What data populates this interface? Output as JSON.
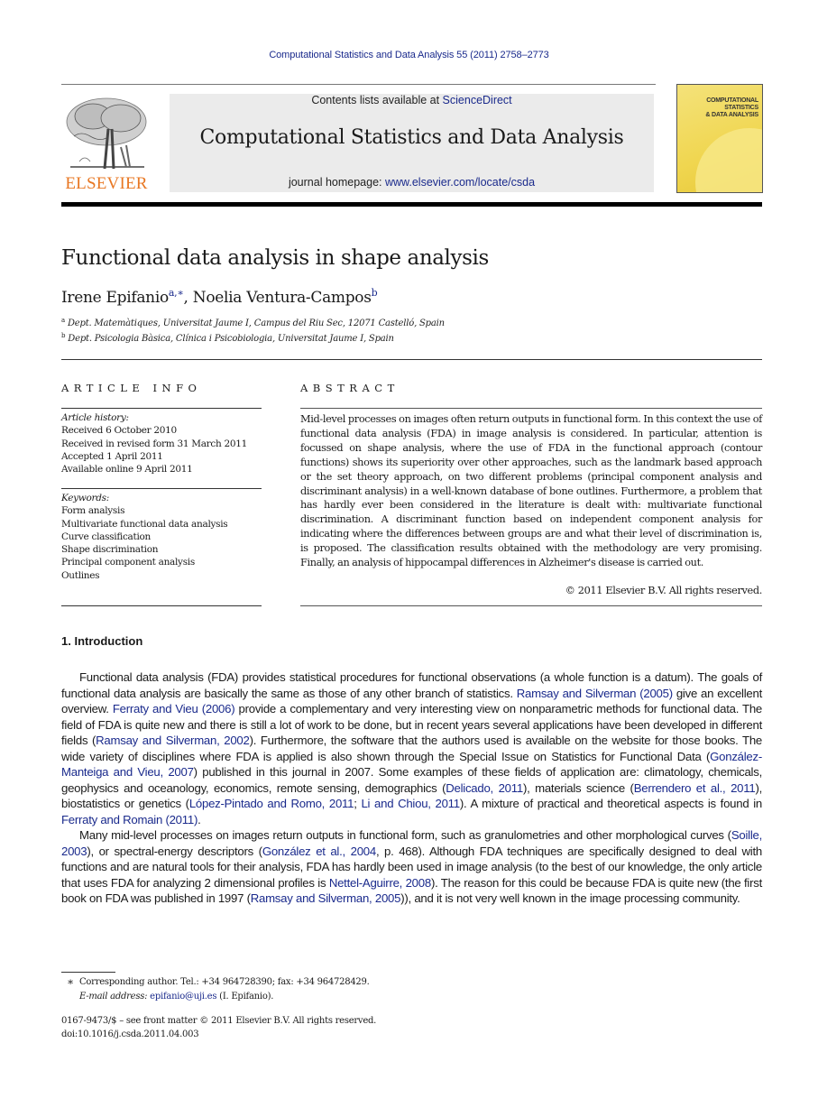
{
  "running_head": "Computational Statistics and Data Analysis 55 (2011) 2758–2773",
  "publisher": {
    "name": "ELSEVIER",
    "brand_color": "#e87722"
  },
  "journal_header": {
    "contents_prefix": "Contents lists available at ",
    "contents_link": "ScienceDirect",
    "journal_name": "Computational Statistics and Data Analysis",
    "homepage_prefix": "journal homepage: ",
    "homepage_link": "www.elsevier.com/locate/csda",
    "cover_title_lines": [
      "COMPUTATIONAL",
      "STATISTICS",
      "& DATA ANALYSIS"
    ]
  },
  "article": {
    "title": "Functional data analysis in shape analysis",
    "authors": [
      {
        "name": "Irene Epifanio",
        "marks": "a,∗"
      },
      {
        "name": "Noelia Ventura-Campos",
        "marks": "b"
      }
    ],
    "author_separator": ", ",
    "affiliations": [
      {
        "mark": "a",
        "text": "Dept. Matemàtiques, Universitat Jaume I, Campus del Riu Sec, 12071 Castelló, Spain"
      },
      {
        "mark": "b",
        "text": "Dept. Psicologia Bàsica, Clínica i Psicobiologia, Universitat Jaume I, Spain"
      }
    ]
  },
  "article_info": {
    "heading": "ARTICLE INFO",
    "history_label": "Article history:",
    "history": [
      "Received 6 October 2010",
      "Received in revised form 31 March 2011",
      "Accepted 1 April 2011",
      "Available online 9 April 2011"
    ],
    "keywords_label": "Keywords:",
    "keywords": [
      "Form analysis",
      "Multivariate functional data analysis",
      "Curve classification",
      "Shape discrimination",
      "Principal component analysis",
      "Outlines"
    ]
  },
  "abstract": {
    "heading": "ABSTRACT",
    "text": "Mid-level processes on images often return outputs in functional form. In this context the use of functional data analysis (FDA) in image analysis is considered. In particular, attention is focussed on shape analysis, where the use of FDA in the functional approach (contour functions) shows its superiority over other approaches, such as the landmark based approach or the set theory approach, on two different problems (principal component analysis and discriminant analysis) in a well-known database of bone outlines. Furthermore, a problem that has hardly ever been considered in the literature is dealt with: multivariate functional discrimination. A discriminant function based on independent component analysis for indicating where the differences between groups are and what their level of discrimination is, is proposed. The classification results obtained with the methodology are very promising. Finally, an analysis of hippocampal differences in Alzheimer's disease is carried out.",
    "copyright": "© 2011 Elsevier B.V. All rights reserved."
  },
  "introduction": {
    "heading": "1.  Introduction",
    "paragraphs": [
      [
        {
          "t": "Functional data analysis (FDA) provides statistical procedures for functional observations (a whole function is a datum). The goals of functional data analysis are basically the same as those of any other branch of statistics. "
        },
        {
          "t": "Ramsay and Silverman (2005)",
          "link": true
        },
        {
          "t": " give an excellent overview. "
        },
        {
          "t": "Ferraty and Vieu (2006)",
          "link": true
        },
        {
          "t": " provide a complementary and very interesting view on nonparametric methods for functional data. The field of FDA is quite new and there is still a lot of work to be done, but in recent years several applications have been developed in different fields ("
        },
        {
          "t": "Ramsay and Silverman, 2002",
          "link": true
        },
        {
          "t": "). Furthermore, the software that the authors used is available on the website for those books. The wide variety of disciplines where FDA is applied is also shown through the Special Issue on Statistics for Functional Data ("
        },
        {
          "t": "González-Manteiga and Vieu, 2007",
          "link": true
        },
        {
          "t": ") published in this journal in 2007. Some examples of these fields of application are: climatology, chemicals, geophysics and oceanology, economics, remote sensing, demographics ("
        },
        {
          "t": "Delicado, 2011",
          "link": true
        },
        {
          "t": "), materials science ("
        },
        {
          "t": "Berrendero et al., 2011",
          "link": true
        },
        {
          "t": "), biostatistics or genetics ("
        },
        {
          "t": "López-Pintado and Romo, 2011",
          "link": true
        },
        {
          "t": "; "
        },
        {
          "t": "Li and Chiou, 2011",
          "link": true
        },
        {
          "t": "). A mixture of practical and theoretical aspects is found in "
        },
        {
          "t": "Ferraty and Romain (2011)",
          "link": true
        },
        {
          "t": "."
        }
      ],
      [
        {
          "t": "Many mid-level processes on images return outputs in functional form, such as granulometries and other morphological curves ("
        },
        {
          "t": "Soille, 2003",
          "link": true
        },
        {
          "t": "), or spectral-energy descriptors ("
        },
        {
          "t": "González et al., 2004",
          "link": true
        },
        {
          "t": ", p. 468). Although FDA techniques are specifically designed to deal with functions and are natural tools for their analysis, FDA has hardly been used in image analysis (to the best of our knowledge, the only article that uses FDA for analyzing 2 dimensional profiles is "
        },
        {
          "t": "Nettel-Aguirre, 2008",
          "link": true
        },
        {
          "t": "). The reason for this could be because FDA is quite new (the first book on FDA was published in 1997 ("
        },
        {
          "t": "Ramsay and Silverman, 2005",
          "link": true
        },
        {
          "t": ")), and it is not very well known in the image processing community."
        }
      ]
    ]
  },
  "footnotes": {
    "star": "∗",
    "corresponding": "Corresponding author. Tel.: +34 964728390; fax: +34 964728429.",
    "email_label": "E-mail address: ",
    "email": "epifanio@uji.es",
    "email_suffix": " (I. Epifanio).",
    "issn_line": "0167-9473/$ – see front matter © 2011 Elsevier B.V. All rights reserved.",
    "doi": "doi:10.1016/j.csda.2011.04.003"
  },
  "link_color": "#1a2a8c"
}
